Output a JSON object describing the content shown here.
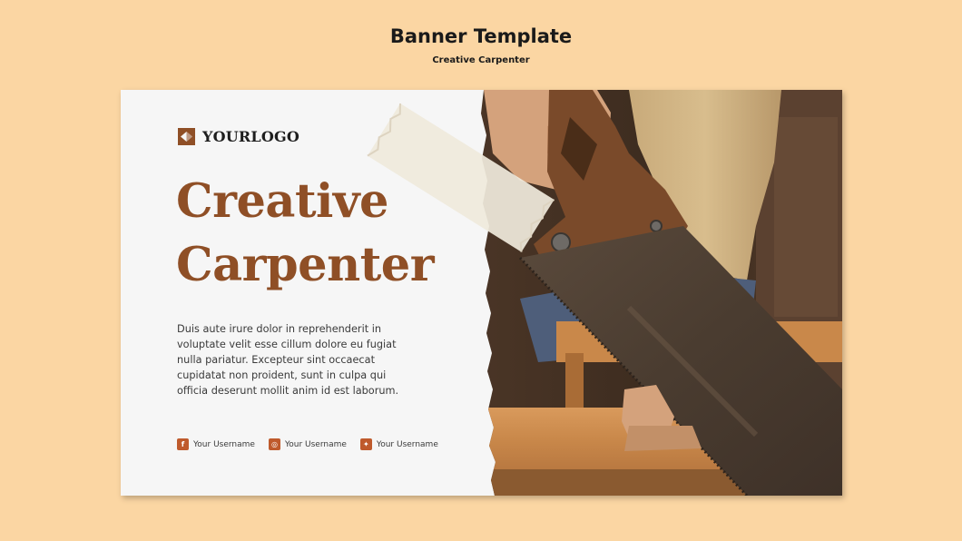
{
  "header": {
    "title": "Banner Template",
    "subtitle": "Creative Carpenter"
  },
  "banner": {
    "logo_text": "YOURLOGO",
    "headline_line1": "Creative",
    "headline_line2": "Carpenter",
    "body": "Duis aute irure dolor in reprehenderit in voluptate velit esse cillum dolore eu fugiat nulla pariatur. Excepteur sint occaecat cupidatat non proident, sunt in culpa qui officia deserunt mollit anim id est laborum.",
    "photo_icon": "carpenter-saw-photo",
    "socials": [
      {
        "icon": "facebook-icon",
        "glyph": "f",
        "label": "Your Username"
      },
      {
        "icon": "instagram-icon",
        "glyph": "◎",
        "label": "Your Username"
      },
      {
        "icon": "twitter-icon",
        "glyph": "✦",
        "label": "Your Username"
      }
    ]
  },
  "colors": {
    "page_background": "#fbd6a3",
    "banner_background": "#f6f6f6",
    "headline": "#8f4f26",
    "social_icon": "#bf5a2c"
  }
}
